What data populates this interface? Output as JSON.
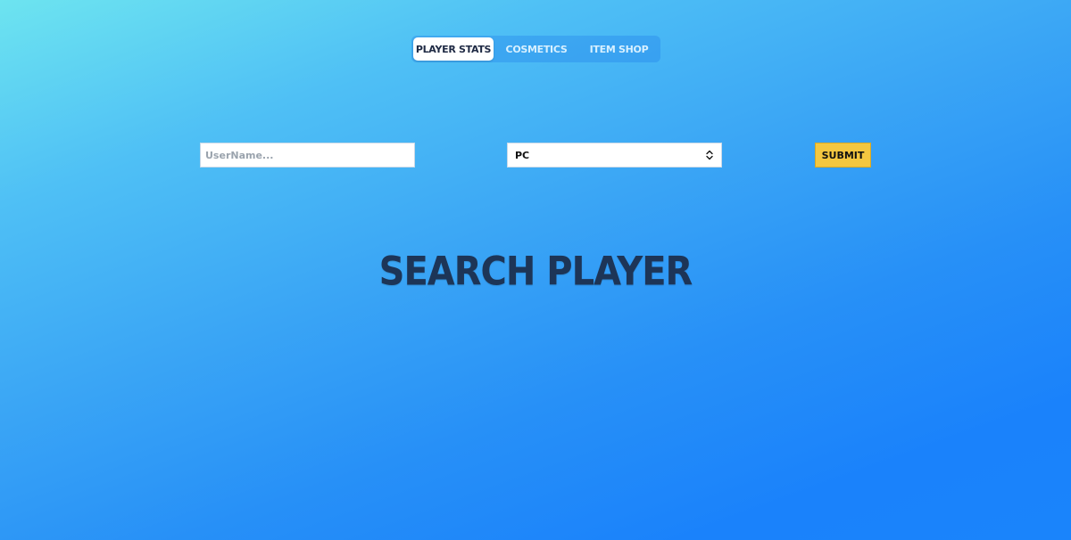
{
  "nav": {
    "tabs": [
      {
        "label": "PLAYER STATS",
        "active": true
      },
      {
        "label": "COSMETICS",
        "active": false
      },
      {
        "label": "ITEM SHOP",
        "active": false
      }
    ]
  },
  "search": {
    "username_placeholder": "UserName...",
    "username_value": "",
    "platform_selected": "PC",
    "submit_label": "SUBMIT"
  },
  "main": {
    "title": "SEARCH PLAYER"
  },
  "icons": {
    "platform_select_indicator": "updown-chevron-icon"
  },
  "colors": {
    "submit_bg": "#f4c740",
    "title": "#1d3557",
    "gradient_start": "#6de4f0",
    "gradient_end": "#1a82fb"
  }
}
